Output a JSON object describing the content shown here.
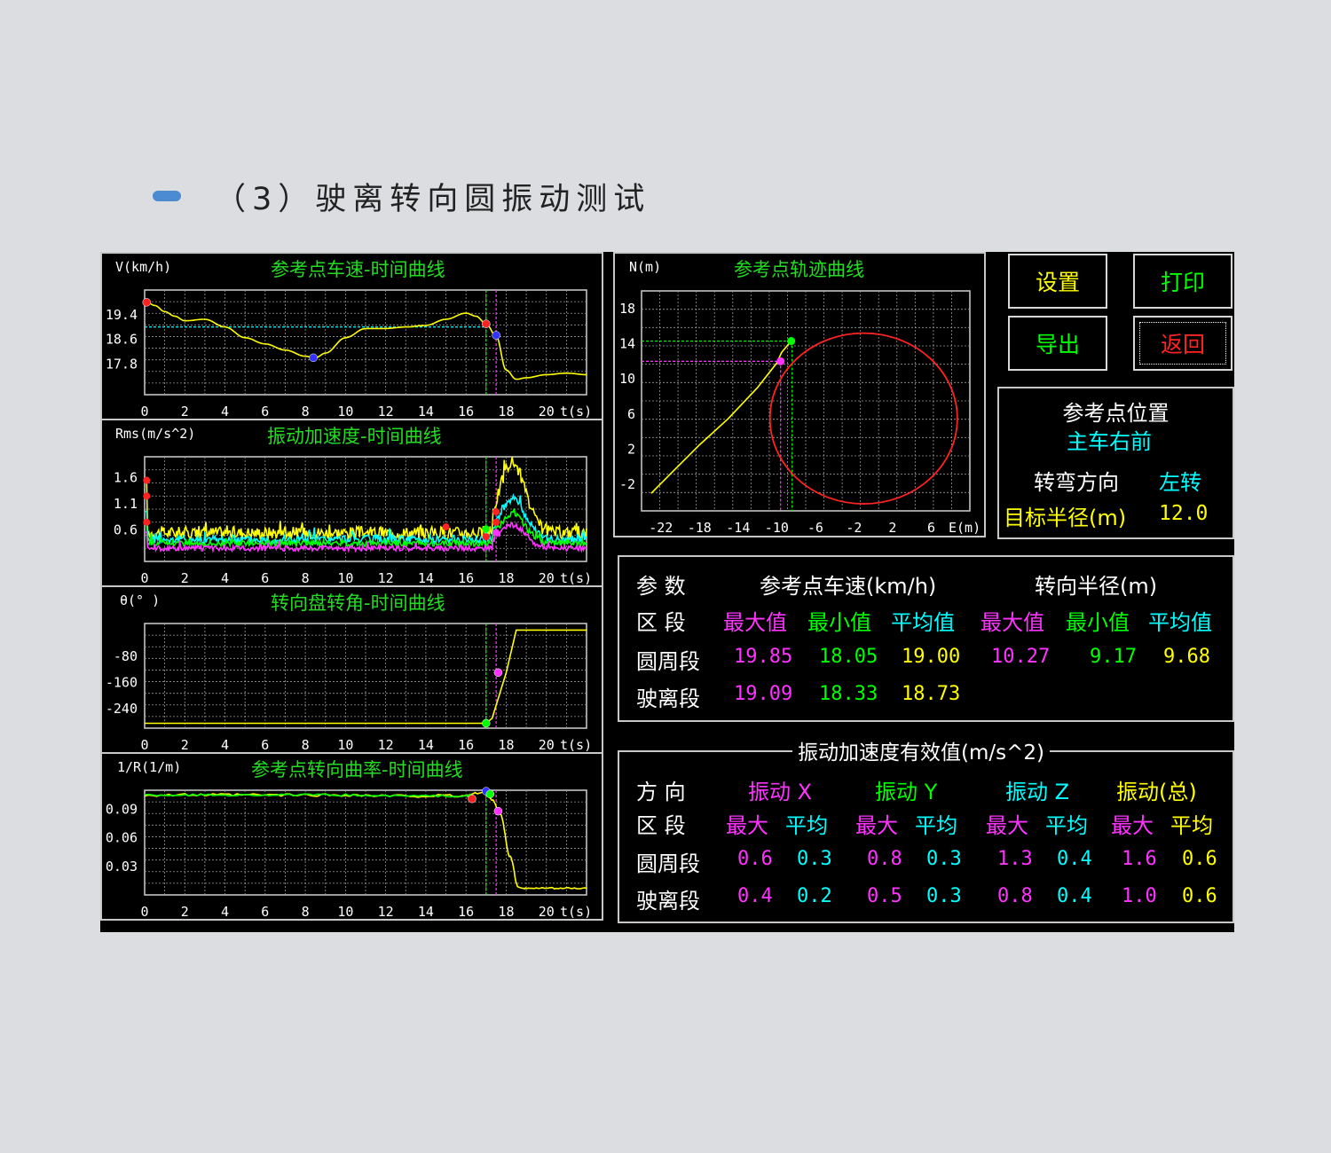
{
  "page": {
    "heading": "（3）驶离转向圆振动测试"
  },
  "colors": {
    "yellow": "#ffff00",
    "green": "#00ff00",
    "cyan": "#00ffff",
    "magenta": "#ff33ff",
    "red": "#ff2222",
    "blue": "#3333ff",
    "white": "#ffffff",
    "title": "#22dd22"
  },
  "charts": {
    "speed": {
      "ylabel": "V(km/h)",
      "title": "参考点车速-时间曲线",
      "xticks": [
        "0",
        "2",
        "4",
        "6",
        "8",
        "10",
        "12",
        "14",
        "16",
        "18",
        "20"
      ],
      "xunit": "t(s)",
      "yticks": [
        "19.4",
        "18.6",
        "17.8"
      ]
    },
    "vibration": {
      "ylabel": "Rms(m/s^2)",
      "title": "振动加速度-时间曲线",
      "xticks": [
        "0",
        "2",
        "4",
        "6",
        "8",
        "10",
        "12",
        "14",
        "16",
        "18",
        "20"
      ],
      "xunit": "t(s)",
      "yticks": [
        "1.6",
        "1.1",
        "0.6"
      ]
    },
    "steering": {
      "ylabel": "θ(° )",
      "title": "转向盘转角-时间曲线",
      "xticks": [
        "0",
        "2",
        "4",
        "6",
        "8",
        "10",
        "12",
        "14",
        "16",
        "18",
        "20"
      ],
      "xunit": "t(s)",
      "yticks": [
        "-80",
        "-160",
        "-240"
      ]
    },
    "curvature": {
      "ylabel": "1/R(1/m)",
      "title": "参考点转向曲率-时间曲线",
      "xticks": [
        "0",
        "2",
        "4",
        "6",
        "8",
        "10",
        "12",
        "14",
        "16",
        "18",
        "20"
      ],
      "xunit": "t(s)",
      "yticks": [
        "0.09",
        "0.06",
        "0.03"
      ]
    },
    "trajectory": {
      "ylabel": "N(m)",
      "title": "参考点轨迹曲线",
      "xticks": [
        "-22",
        "-18",
        "-14",
        "-10",
        "-6",
        "-2",
        "2",
        "6"
      ],
      "xunit": "E(m)",
      "yticks": [
        "18",
        "14",
        "10",
        "6",
        "2",
        "-2"
      ]
    }
  },
  "chart_data": [
    {
      "type": "line",
      "title": "参考点车速-时间曲线",
      "xlabel": "t(s)",
      "ylabel": "V(km/h)",
      "xlim": [
        0,
        22
      ],
      "ylim": [
        16.8,
        20.2
      ],
      "series": [
        {
          "color": "#ffff00",
          "x": [
            0,
            0.5,
            1,
            1.5,
            2,
            3,
            4,
            5,
            6,
            7,
            8,
            8.5,
            9,
            10,
            11,
            12,
            13,
            14,
            15,
            16,
            16.5,
            17,
            17.5,
            18,
            18.5,
            19,
            20,
            21,
            22
          ],
          "y": [
            19.85,
            19.7,
            19.5,
            19.35,
            19.2,
            19.25,
            19.0,
            18.65,
            18.45,
            18.25,
            18.05,
            18.0,
            18.15,
            18.65,
            18.95,
            18.95,
            19.0,
            19.05,
            19.25,
            19.45,
            19.35,
            19.1,
            18.7,
            17.6,
            17.3,
            17.35,
            17.45,
            17.5,
            17.45
          ]
        }
      ],
      "ref_lines": {
        "h": 19.0,
        "v_green": 17.0,
        "v_magenta": 17.5
      },
      "markers": [
        {
          "x": 0.1,
          "y": 19.8,
          "color": "red"
        },
        {
          "x": 8.4,
          "y": 18.0,
          "color": "blue"
        },
        {
          "x": 17.0,
          "y": 19.1,
          "color": "red"
        },
        {
          "x": 17.5,
          "y": 18.73,
          "color": "blue"
        }
      ]
    },
    {
      "type": "line",
      "title": "振动加速度-时间曲线",
      "xlabel": "t(s)",
      "ylabel": "Rms(m/s^2)",
      "xlim": [
        0,
        22
      ],
      "ylim": [
        0,
        2.0
      ],
      "series": [
        {
          "name": "振动(总)",
          "color": "#ffff00",
          "base": 0.55,
          "noise": 0.12,
          "peak": 1.9
        },
        {
          "name": "振动 Z",
          "color": "#00ffff",
          "base": 0.42,
          "noise": 0.08,
          "peak": 1.2
        },
        {
          "name": "振动 Y",
          "color": "#00ff00",
          "base": 0.35,
          "noise": 0.06,
          "peak": 0.9
        },
        {
          "name": "振动 X",
          "color": "#ff33ff",
          "base": 0.25,
          "noise": 0.05,
          "peak": 0.7
        }
      ],
      "ref_lines": {
        "v_green": 17.0,
        "v_magenta": 17.5
      }
    },
    {
      "type": "line",
      "title": "转向盘转角-时间曲线",
      "xlabel": "t(s)",
      "ylabel": "θ(°)",
      "xlim": [
        0,
        22
      ],
      "ylim": [
        -300,
        20
      ],
      "series": [
        {
          "color": "#ffff00",
          "x": [
            0,
            17.0,
            17.3,
            18.0,
            18.5,
            19,
            20,
            21,
            22
          ],
          "y": [
            -285,
            -285,
            -270,
            -130,
            0,
            0,
            0,
            0,
            0
          ]
        }
      ],
      "ref_lines": {
        "v_green": 17.0,
        "v_magenta": 17.5
      },
      "markers": [
        {
          "x": 17.0,
          "y": -285,
          "color": "green"
        },
        {
          "x": 17.6,
          "y": -130,
          "color": "magenta"
        }
      ]
    },
    {
      "type": "line",
      "title": "参考点转向曲率-时间曲线",
      "xlabel": "t(s)",
      "ylabel": "1/R(1/m)",
      "xlim": [
        0,
        22
      ],
      "ylim": [
        0,
        0.11
      ],
      "series": [
        {
          "color": "#ffff00",
          "x": [
            0,
            2,
            4,
            6,
            8,
            10,
            12,
            14,
            16,
            16.5,
            17,
            17.3,
            17.7,
            18.2,
            18.6,
            19,
            20,
            21,
            22
          ],
          "y": [
            0.105,
            0.105,
            0.105,
            0.105,
            0.105,
            0.105,
            0.104,
            0.104,
            0.104,
            0.107,
            0.108,
            0.1,
            0.085,
            0.04,
            0.008,
            0.007,
            0.007,
            0.007,
            0.007
          ]
        }
      ],
      "ref_lines": {
        "v_green": 17.0,
        "v_magenta": 17.5
      },
      "markers": [
        {
          "x": 16.3,
          "y": 0.101,
          "color": "red"
        },
        {
          "x": 17.0,
          "y": 0.109,
          "color": "blue"
        },
        {
          "x": 17.2,
          "y": 0.106,
          "color": "green"
        },
        {
          "x": 17.6,
          "y": 0.088,
          "color": "magenta"
        }
      ]
    },
    {
      "type": "scatter",
      "title": "参考点轨迹曲线",
      "xlabel": "E(m)",
      "ylabel": "N(m)",
      "xlim": [
        -24,
        10
      ],
      "ylim": [
        -5,
        20
      ],
      "circle": {
        "cx": -1.0,
        "cy": 5.5,
        "r": 9.7,
        "color": "#ff2222"
      },
      "series": [
        {
          "color": "#ffff00",
          "x": [
            -23,
            -21,
            -18,
            -15,
            -12,
            -10,
            -9.5,
            -8.5
          ],
          "y": [
            -3.0,
            -0.8,
            2.5,
            5.5,
            9.0,
            11.8,
            13.0,
            14.3
          ]
        }
      ],
      "ref_lines": {
        "h_green": 14.3,
        "h_magenta": 12.0,
        "v_green": -8.4,
        "v_magenta": -9.6
      },
      "markers": [
        {
          "x": -8.5,
          "y": 14.3,
          "color": "green"
        },
        {
          "x": -9.6,
          "y": 12.0,
          "color": "magenta"
        }
      ]
    }
  ],
  "buttons": {
    "settings": "设置",
    "print": "打印",
    "export": "导出",
    "back": "返回"
  },
  "position_box": {
    "title": "参考点位置",
    "position": "主车右前",
    "direction_label": "转弯方向",
    "direction_value": "左转",
    "radius_label": "目标半径(m)",
    "radius_value": "12.0"
  },
  "speed_table": {
    "h_param": "参  数",
    "h_speed": "参考点车速(km/h)",
    "h_radius": "转向半径(m)",
    "h_segment": "区  段",
    "cols": [
      "最大值",
      "最小值",
      "平均值",
      "最大值",
      "最小值",
      "平均值"
    ],
    "rows": [
      {
        "label": "圆周段",
        "values": [
          "19.85",
          "18.05",
          "19.00",
          "10.27",
          "9.17",
          "9.68"
        ]
      },
      {
        "label": "驶离段",
        "values": [
          "19.09",
          "18.33",
          "18.73",
          "",
          "",
          ""
        ]
      }
    ]
  },
  "vib_table": {
    "legend": "振动加速度有效值(m/s^2)",
    "h_direction": "方  向",
    "h_segment": "区  段",
    "groups": [
      "振动  X",
      "振动  Y",
      "振动  Z",
      "振动(总)"
    ],
    "sub": [
      "最大",
      "平均",
      "最大",
      "平均",
      "最大",
      "平均",
      "最大",
      "平均"
    ],
    "rows": [
      {
        "label": "圆周段",
        "values": [
          "0.6",
          "0.3",
          "0.8",
          "0.3",
          "1.3",
          "0.4",
          "1.6",
          "0.6"
        ]
      },
      {
        "label": "驶离段",
        "values": [
          "0.4",
          "0.2",
          "0.5",
          "0.3",
          "0.8",
          "0.4",
          "1.0",
          "0.6"
        ]
      }
    ]
  }
}
